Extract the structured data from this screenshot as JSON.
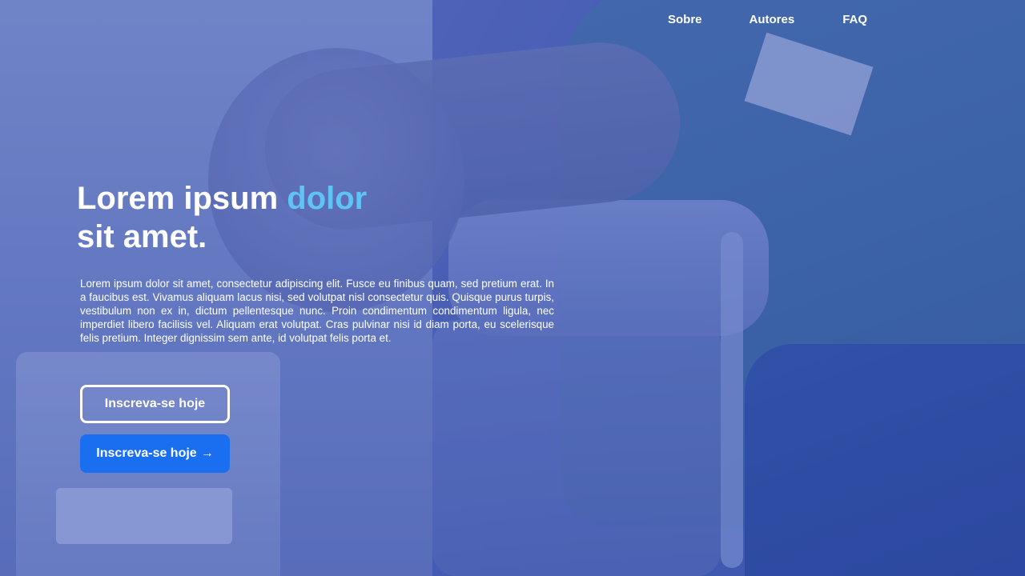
{
  "nav": {
    "items": [
      {
        "label": "Sobre"
      },
      {
        "label": "Autores"
      },
      {
        "label": "FAQ"
      }
    ]
  },
  "hero": {
    "headline_part1": "Lorem ipsum ",
    "headline_accent": "dolor",
    "headline_part2": "sit amet.",
    "body": "Lorem ipsum dolor sit amet, consectetur adipiscing elit. Fusce eu finibus quam, sed pretium erat. In a faucibus est. Vivamus aliquam lacus nisi, sed volutpat nisl consectetur quis. Quisque purus turpis, vestibulum non ex in, dictum pellentesque nunc. Proin condimentum condimentum ligula, nec imperdiet libero facilisis vel. Aliquam erat volutpat. Cras pulvinar nisi id diam porta, eu scelerisque felis pretium. Integer dignissim sem ante, id volutpat felis porta et.",
    "cta_outline_label": "Inscreva-se hoje",
    "cta_primary_label": "Inscreva-se hoje",
    "cta_primary_arrow": "→"
  },
  "colors": {
    "accent": "#5ec4f6",
    "primary_button": "#1a6ef0",
    "overlay": "#374baa"
  },
  "icons": {
    "cta_arrow": "arrow-right-icon"
  }
}
